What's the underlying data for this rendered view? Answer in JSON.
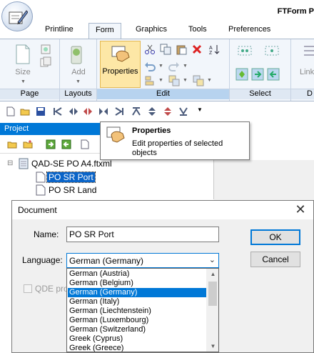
{
  "app": {
    "title": "FTForm P"
  },
  "tabs": [
    "Printline",
    "Form",
    "Graphics",
    "Tools",
    "Preferences"
  ],
  "ribbon": {
    "groups": [
      {
        "label": "Page",
        "button": "Size"
      },
      {
        "label": "Layouts",
        "button": "Add"
      },
      {
        "label": "Edit",
        "button": "Properties"
      },
      {
        "label": "Select"
      },
      {
        "label": "D",
        "button": "Link"
      }
    ]
  },
  "project": {
    "header": "Project"
  },
  "tree": {
    "root": "QAD-SE PO A4.ftxml",
    "items": [
      "PO SR Port",
      "PO SR Land"
    ]
  },
  "tooltip": {
    "title": "Properties",
    "description": "Edit properties of selected objects"
  },
  "dialog": {
    "title": "Document",
    "name_label": "Name:",
    "name_value": "PO SR Port",
    "language_label": "Language:",
    "language_value": "German (Germany)",
    "ok_label": "OK",
    "cancel_label": "Cancel",
    "qde_label": "QDE pron",
    "languages": [
      "German (Austria)",
      "German (Belgium)",
      "German (Germany)",
      "German (Italy)",
      "German (Liechtenstein)",
      "German (Luxembourg)",
      "German (Switzerland)",
      "Greek (Cyprus)",
      "Greek (Greece)"
    ],
    "selected_index": 2
  },
  "colors": {
    "accent": "#0078d7",
    "tooltip_highlight": "#fde7a6"
  }
}
